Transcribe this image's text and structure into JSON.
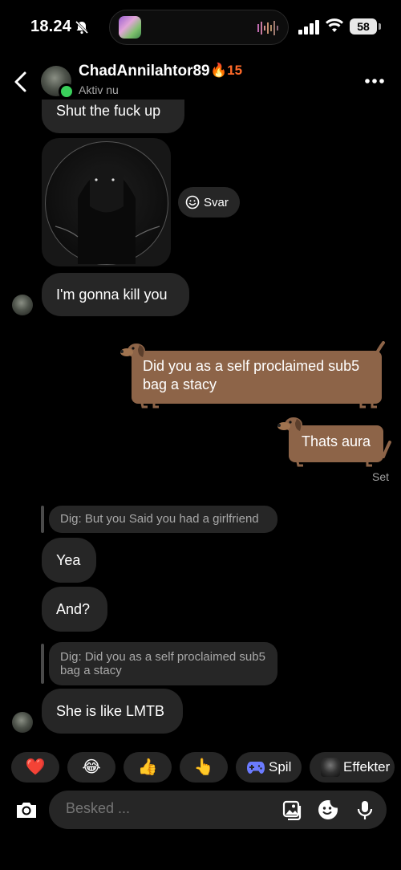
{
  "status": {
    "time": "18.24",
    "battery": "58"
  },
  "header": {
    "name": "ChadAnnilahtor89",
    "streak": "🔥15",
    "sub": "Aktiv nu"
  },
  "messages": {
    "top_partial": "Shut the fuck up",
    "svar": "Svar",
    "kill": "I'm gonna kill you",
    "sent1": "Did you as a self proclaimed sub5 bag a stacy",
    "sent2": "Thats aura",
    "sent_status": "Set",
    "reply1": "Dig: But you Said you had a girlfriend",
    "yea": "Yea",
    "and": "And?",
    "reply2": "Dig: Did you as a self proclaimed sub5 bag a stacy",
    "lmtb": "She is like LMTB"
  },
  "quick": {
    "heart": "❤️",
    "laugh": "😂",
    "thumbs": "👍",
    "point": "👆",
    "games": "Spil",
    "effects": "Effekter"
  },
  "composer": {
    "placeholder": "Besked ..."
  },
  "colors": {
    "bubble": "#262626",
    "sent": "#8d6448",
    "online": "#3ad05b",
    "streak": "#ff6a2a"
  }
}
